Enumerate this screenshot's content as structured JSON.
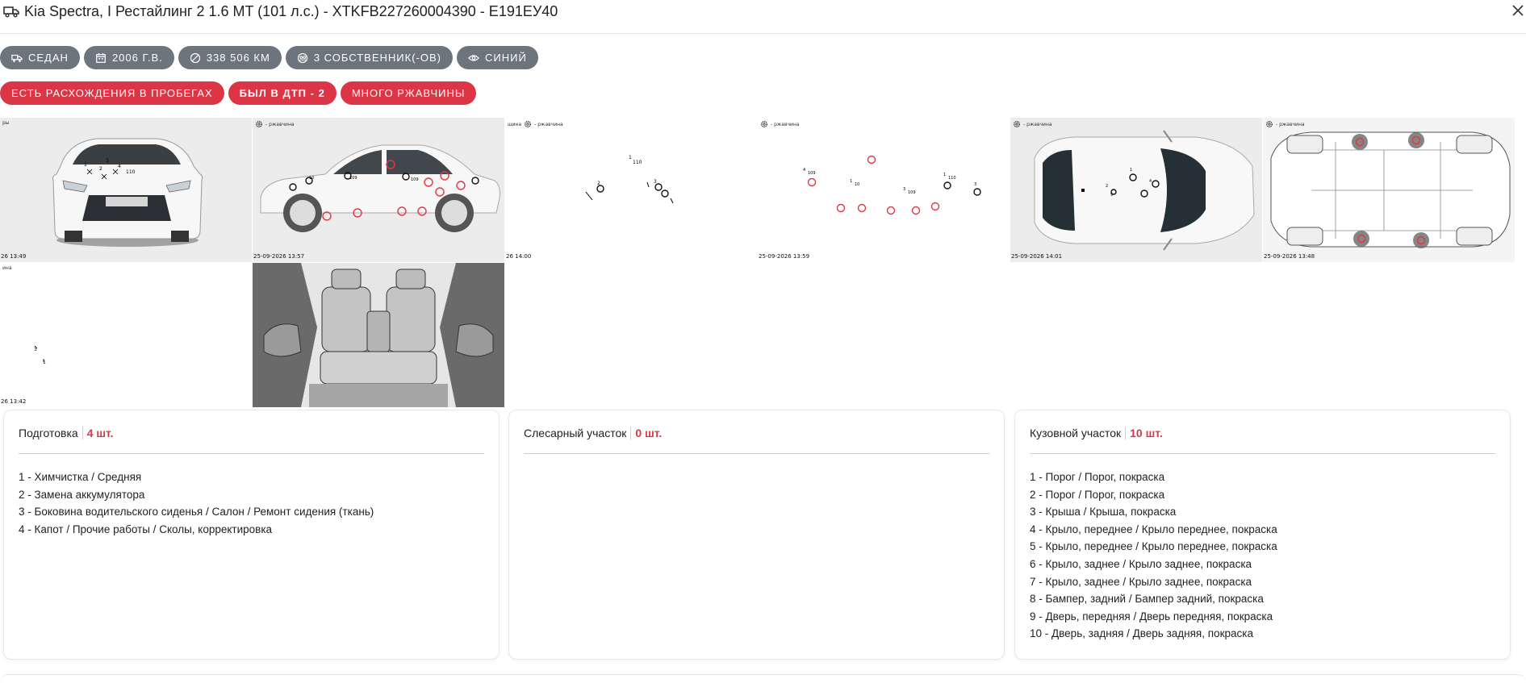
{
  "header": {
    "title": "Kia Spectra, I Рестайлинг 2 1.6 MT (101 л.с.) - XTKFB227260004390 - Е191ЕУ40",
    "truck_icon": "truck-icon",
    "close_icon": "close-icon"
  },
  "chips": [
    {
      "label": "Седан",
      "icon": "car-icon"
    },
    {
      "label": "2006 г.в.",
      "icon": "calendar-icon"
    },
    {
      "label": "338 506 км",
      "icon": "speedometer-icon"
    },
    {
      "label": "3 собственник(-ов)",
      "icon": "owners-icon"
    },
    {
      "label": "Синий",
      "icon": "eye-icon"
    }
  ],
  "alerts": [
    {
      "label": "Есть расхождения в пробегах"
    },
    {
      "label": "Был в ДТП - 2"
    },
    {
      "label": "Много ржавчины"
    }
  ],
  "colors": {
    "chip_gray": "#6c757d",
    "alert_red": "#dc3545"
  },
  "photos": [
    {
      "stamp": "26 13:49",
      "tag": "ры"
    },
    {
      "stamp": "25-09-2026 13:57",
      "tag": "- ржавчина"
    },
    {
      "stamp": "26 14:00",
      "tag": "- ржавчина",
      "tag_prefix": "щина"
    },
    {
      "stamp": "25-09-2026 13:59",
      "tag": "- ржавчина"
    },
    {
      "stamp": "25-09-2026 14:01",
      "tag": "- ржавчина"
    },
    {
      "stamp": "25-09-2026 13:48",
      "tag": "- ржавчина"
    },
    {
      "stamp": "26 13:42",
      "tag": "ина"
    },
    {
      "stamp": "",
      "tag": ""
    }
  ],
  "cards": [
    {
      "title": "Подготовка",
      "count": "4 шт.",
      "items": [
        "1 - Химчистка / Средняя",
        "2 - Замена аккумулятора",
        "3 - Боковина водительского сиденья / Салон / Ремонт сидения (ткань)",
        "4 - Капот / Прочие работы / Сколы, корректировка"
      ]
    },
    {
      "title": "Слесарный участок",
      "count": "0 шт.",
      "items": []
    },
    {
      "title": "Кузовной участок",
      "count": "10 шт.",
      "items": [
        "1 - Порог / Порог, покраска",
        "2 - Порог / Порог, покраска",
        "3 - Крыша / Крыша, покраска",
        "4 - Крыло, переднее / Крыло переднее, покраска",
        "5 - Крыло, переднее / Крыло переднее, покраска",
        "6 - Крыло, заднее / Крыло заднее, покраска",
        "7 - Крыло, заднее / Крыло заднее, покраска",
        "8 - Бампер, задний / Бампер задний, покраска",
        "9 - Дверь, передняя / Дверь передняя, покраска",
        "10 - Дверь, задняя / Дверь задняя, покраска"
      ]
    }
  ]
}
